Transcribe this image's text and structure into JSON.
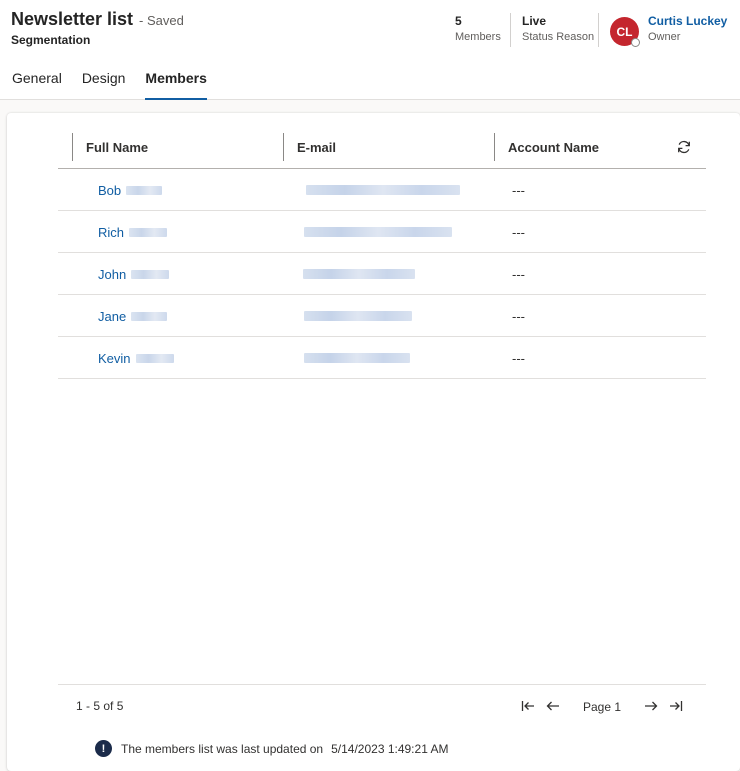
{
  "header": {
    "title": "Newsletter list",
    "saved_status": "- Saved",
    "subtitle": "Segmentation",
    "kpis": [
      {
        "value": "5",
        "label": "Members"
      },
      {
        "value": "Live",
        "label": "Status Reason"
      }
    ],
    "owner": {
      "initials": "CL",
      "name": "Curtis Luckey",
      "label": "Owner",
      "avatar_color": "#c4262e"
    }
  },
  "tabs": [
    {
      "label": "General",
      "active": false
    },
    {
      "label": "Design",
      "active": false
    },
    {
      "label": "Members",
      "active": true
    }
  ],
  "grid": {
    "columns": [
      "Full Name",
      "E-mail",
      "Account Name"
    ],
    "refresh_icon": "refresh-icon",
    "rows": [
      {
        "first_name": "Bob",
        "account": "---"
      },
      {
        "first_name": "Rich",
        "account": "---"
      },
      {
        "first_name": "John",
        "account": "---"
      },
      {
        "first_name": "Jane",
        "account": "---"
      },
      {
        "first_name": "Kevin",
        "account": "---"
      }
    ]
  },
  "pagination": {
    "range": "1 - 5 of 5",
    "page_label": "Page 1"
  },
  "notice": {
    "text": "The members list was last updated on",
    "date": "5/14/2023 1:49:21 AM"
  },
  "colors": {
    "accent": "#115ea3",
    "link": "#115ea3"
  }
}
